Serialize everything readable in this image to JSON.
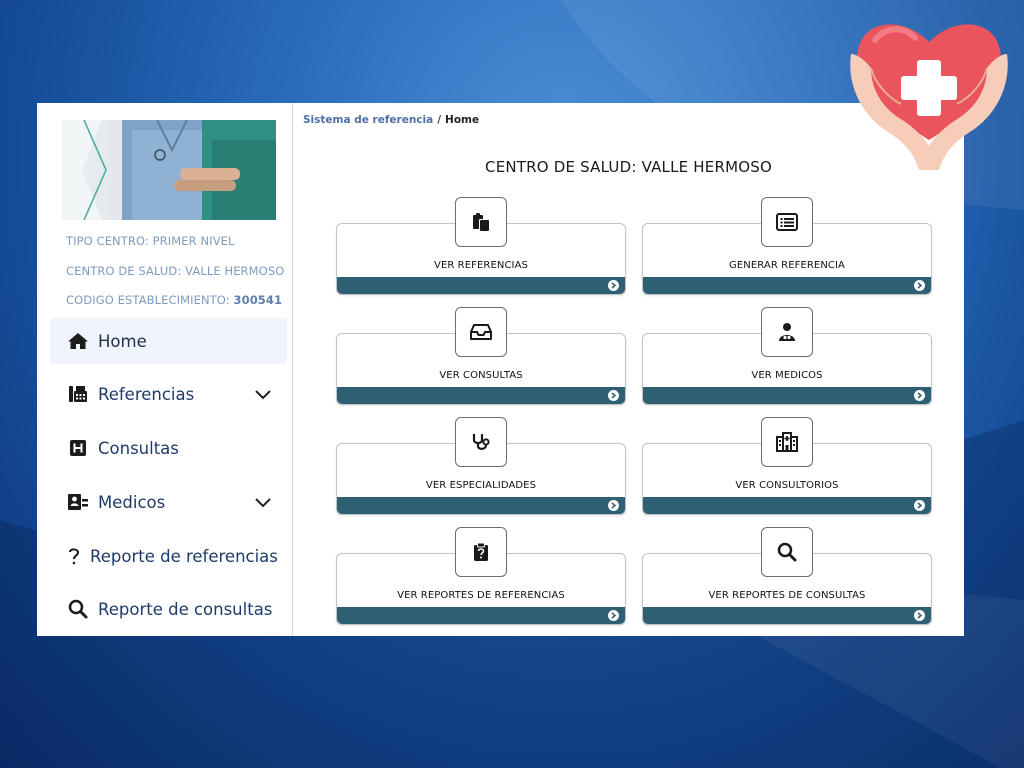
{
  "breadcrumb": {
    "root": "Sistema de referencia",
    "separator": "/",
    "current": "Home"
  },
  "sidebar": {
    "info": {
      "tipo": "TIPO CENTRO: PRIMER NIVEL",
      "centro": "CENTRO DE SALUD: VALLE HERMOSO",
      "codigo_label": "CODIGO ESTABLECIMIENTO: ",
      "codigo_value": "300541"
    },
    "nav": [
      {
        "label": "Home",
        "icon": "home-icon",
        "active": true
      },
      {
        "label": "Referencias",
        "icon": "fax-icon",
        "expandable": true
      },
      {
        "label": "Consultas",
        "icon": "hospital-sign-icon"
      },
      {
        "label": "Medicos",
        "icon": "id-card-icon",
        "expandable": true
      },
      {
        "label": "Reporte de referencias",
        "icon": "question-icon"
      },
      {
        "label": "Reporte de consultas",
        "icon": "search-icon"
      }
    ]
  },
  "main": {
    "title": "CENTRO DE SALUD: VALLE HERMOSO",
    "cards": [
      {
        "label": "VER REFERENCIAS",
        "icon": "paste-icon"
      },
      {
        "label": "GENERAR REFERENCIA",
        "icon": "list-alt-icon"
      },
      {
        "label": "VER CONSULTAS",
        "icon": "inbox-icon"
      },
      {
        "label": "VER MEDICOS",
        "icon": "doctor-icon"
      },
      {
        "label": "VER ESPECIALIDADES",
        "icon": "stethoscope-icon"
      },
      {
        "label": "VER CONSULTORIOS",
        "icon": "hospital-icon"
      },
      {
        "label": "VER REPORTES DE REFERENCIAS",
        "icon": "clipboard-question-icon"
      },
      {
        "label": "VER REPORTES DE CONSULTAS",
        "icon": "search-icon"
      }
    ]
  },
  "colors": {
    "card_footer": "#2e5f72",
    "nav_text": "#1d3b6b",
    "info_text": "#7e9bbf",
    "breadcrumb_link": "#4f6fa8",
    "background": "#2a6cbc"
  }
}
